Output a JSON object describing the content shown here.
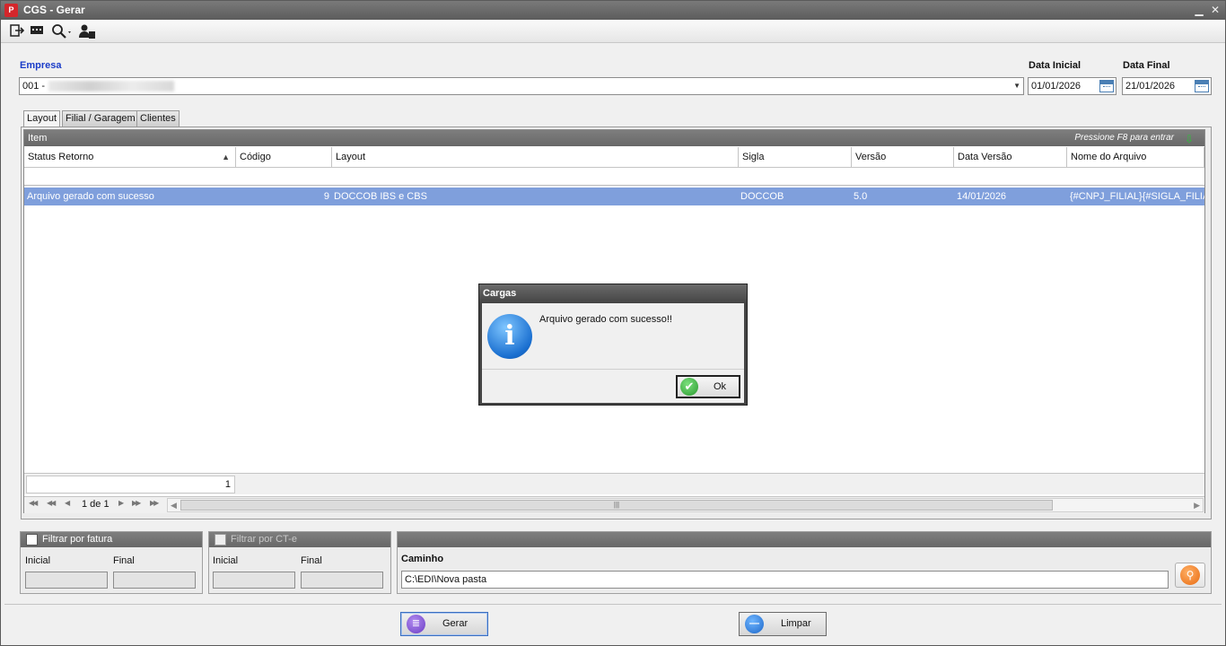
{
  "window": {
    "title": "CGS - Gerar",
    "app_icon_letter": "P"
  },
  "toolbar": {
    "icons": [
      "exit-icon",
      "message-icon",
      "search-icon",
      "user-icon"
    ]
  },
  "empresa": {
    "label": "Empresa",
    "value_prefix": "001 -"
  },
  "data_inicial": {
    "label": "Data Inicial",
    "value": "01/01/2026"
  },
  "data_final": {
    "label": "Data Final",
    "value": "21/01/2026"
  },
  "tabs": [
    {
      "label": "Layout"
    },
    {
      "label": "Filial / Garagem"
    },
    {
      "label": "Clientes"
    }
  ],
  "grid": {
    "group_label": "Item",
    "hint": "Pressione F8 para entrar",
    "columns": [
      "Status Retorno",
      "Código",
      "Layout",
      "Sigla",
      "Versão",
      "Data Versão",
      "Nome do Arquivo"
    ],
    "rows": [
      {
        "status": "Arquivo gerado com sucesso",
        "codigo": "9",
        "layout": "DOCCOB IBS e CBS",
        "sigla": "DOCCOB",
        "versao": "5.0",
        "data_versao": "14/01/2026",
        "nome_arquivo": "{#CNPJ_FILIAL}{#SIGLA_FILIAL"
      }
    ],
    "footer_count": "1",
    "pager_text": "1 de 1"
  },
  "filtro_fatura": {
    "label": "Filtrar por fatura",
    "inicial": "Inicial",
    "final": "Final"
  },
  "filtro_cte": {
    "label": "Filtrar por CT-e",
    "inicial": "Inicial",
    "final": "Final"
  },
  "caminho": {
    "label": "Caminho",
    "value": "C:\\EDI\\Nova pasta"
  },
  "buttons": {
    "gerar": "Gerar",
    "limpar": "Limpar"
  },
  "dialog": {
    "title": "Cargas",
    "message": "Arquivo gerado com sucesso!!",
    "ok": "Ok"
  }
}
